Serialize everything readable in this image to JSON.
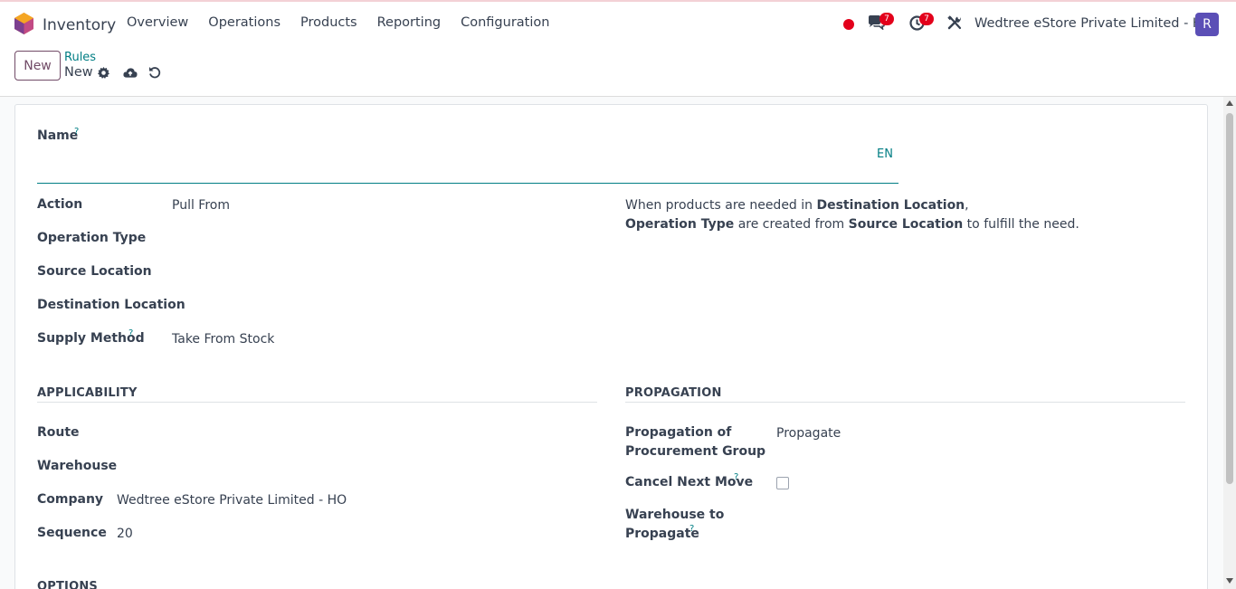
{
  "app": {
    "name": "Inventory",
    "menu": [
      "Overview",
      "Operations",
      "Products",
      "Reporting",
      "Configuration"
    ],
    "messages_badge": "7",
    "activities_badge": "7",
    "company": "Wedtree eStore Private Limited - HO",
    "avatar_letter": "R"
  },
  "control_panel": {
    "new_button": "New",
    "breadcrumb_parent": "Rules",
    "breadcrumb_current": "New"
  },
  "form": {
    "name_label": "Name",
    "help_mark": "?",
    "lang_button": "EN",
    "action_label": "Action",
    "action_value": "Pull From",
    "operation_type_label": "Operation Type",
    "source_location_label": "Source Location",
    "destination_location_label": "Destination Location",
    "supply_method_label": "Supply Method",
    "supply_method_value": "Take From Stock",
    "description": {
      "part1": "When products are needed in ",
      "bold1": "Destination Location",
      "part2": ",",
      "bold2": "Operation Type",
      "part3": " are created from ",
      "bold3": "Source Location",
      "part4": " to fulfill the need."
    },
    "applicability_title": "APPLICABILITY",
    "route_label": "Route",
    "warehouse_label": "Warehouse",
    "company_label": "Company",
    "company_value": "Wedtree eStore Private Limited - HO",
    "sequence_label": "Sequence",
    "sequence_value": "20",
    "propagation_title": "PROPAGATION",
    "propagation_group_label_1": "Propagation of",
    "propagation_group_label_2": "Procurement Group",
    "propagation_group_value": "Propagate",
    "cancel_next_move_label": "Cancel Next Move",
    "warehouse_to_propagate_label_1": "Warehouse to",
    "warehouse_to_propagate_label_2": "Propagate",
    "options_title": "OPTIONS"
  },
  "colors": {
    "brand": "#714b67",
    "link": "#017e84",
    "badge": "#e3001b",
    "avatar": "#5b4fb6"
  }
}
